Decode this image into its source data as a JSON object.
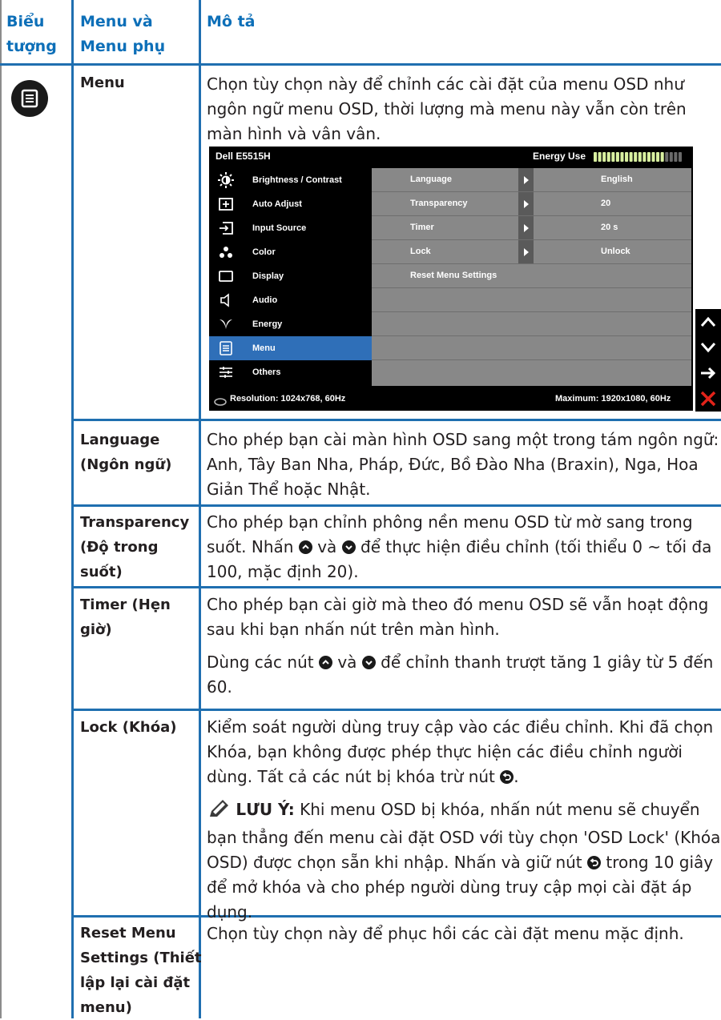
{
  "header": {
    "col1_line1": "Biểu",
    "col1_line2": "tượng",
    "col2_line1": "Menu và",
    "col2_line2": "Menu phụ",
    "col3": "Mô tả"
  },
  "rows": {
    "menu": {
      "label": "Menu",
      "desc_line1": "Chọn tùy chọn này để chỉnh các cài đặt của menu OSD như",
      "desc_line2": "ngôn ngữ menu OSD, thời lượng mà menu này vẫn còn trên",
      "desc_line3": "màn hình và vân vân."
    },
    "language": {
      "label_line1": "Language",
      "label_line2": "(Ngôn ngữ)",
      "desc_line1": "Cho phép bạn cài màn hình OSD sang một trong tám ngôn ngữ:",
      "desc_line2": "Anh, Tây Ban Nha, Pháp, Đức, Bồ Đào Nha (Braxin), Nga, Hoa",
      "desc_line3": "Giản Thể hoặc Nhật."
    },
    "transparency": {
      "label_line1": "Transparency",
      "label_line2": "(Độ trong",
      "label_line3": "suốt)",
      "desc_line1": "Cho phép bạn chỉnh phông nền menu OSD từ mờ sang trong",
      "desc_line2a": "suốt. Nhấn",
      "desc_line2b": "và",
      "desc_line2c": "để thực hiện điều chỉnh (tối thiểu 0 ~ tối đa",
      "desc_line3": "100, mặc định 20)."
    },
    "timer": {
      "label_line1": "Timer (Hẹn",
      "label_line2": "giờ)",
      "desc_line1": "Cho phép bạn cài giờ mà theo đó menu OSD sẽ vẫn hoạt động",
      "desc_line2": "sau khi bạn nhấn nút trên màn hình.",
      "desc_line3a": "Dùng các nút",
      "desc_line3b": "và",
      "desc_line3c": "để chỉnh thanh trượt tăng 1 giây từ 5 đến",
      "desc_line4": "60."
    },
    "lock": {
      "label": "Lock (Khóa)",
      "desc_line1": "Kiểm soát người dùng truy cập vào các điều chỉnh. Khi đã chọn",
      "desc_line2": "Khóa, bạn không được phép thực hiện các điều chỉnh người",
      "desc_line3a": "dùng. Tất cả các nút bị khóa trừ nút",
      "desc_line3b": ".",
      "note_label": "LƯU Ý:",
      "note_line1": "Khi menu OSD bị khóa, nhấn nút menu sẽ chuyển",
      "note_line2": "bạn thẳng đến menu cài đặt OSD với tùy chọn 'OSD Lock' (Khóa",
      "note_line3a": "OSD) được chọn sẵn khi nhập. Nhấn và giữ nút",
      "note_line3b": "trong 10 giây",
      "note_line4": "để mở khóa và cho phép người dùng truy cập mọi cài đặt áp",
      "note_line5": "dụng."
    },
    "reset": {
      "label_line1": "Reset Menu",
      "label_line2": "Settings (Thiết",
      "label_line3": "lập lại cài đặt",
      "label_line4": "menu)",
      "desc_line1": "Chọn tùy chọn này để phục hồi các cài đặt menu mặc định."
    }
  },
  "osd": {
    "model": "Dell E5515H",
    "energy_label": "Energy Use",
    "energy_level": 0.78,
    "left_items": [
      {
        "label": "Brightness / Contrast",
        "icon": "brightness-icon"
      },
      {
        "label": "Auto Adjust",
        "icon": "auto-adjust-icon"
      },
      {
        "label": "Input Source",
        "icon": "input-source-icon"
      },
      {
        "label": "Color",
        "icon": "color-icon"
      },
      {
        "label": "Display",
        "icon": "display-icon"
      },
      {
        "label": "Audio",
        "icon": "speaker-icon"
      },
      {
        "label": "Energy",
        "icon": "energy-leaf-icon"
      },
      {
        "label": "Menu",
        "icon": "menu-icon",
        "selected": true
      },
      {
        "label": "Others",
        "icon": "others-icon"
      }
    ],
    "right_rows": [
      {
        "label": "Language",
        "value": "English"
      },
      {
        "label": "Transparency",
        "value": "20"
      },
      {
        "label": "Timer",
        "value": "20 s"
      },
      {
        "label": "Lock",
        "value": "Unlock"
      },
      {
        "label": "Reset Menu Settings",
        "value": ""
      }
    ],
    "resolution": "Resolution: 1024x768, 60Hz",
    "maximum": "Maximum: 1920x1080, 60Hz",
    "nav_buttons": [
      "up-arrow-icon",
      "down-arrow-icon",
      "right-arrow-icon",
      "close-icon"
    ]
  },
  "colors": {
    "header_text": "#0d6fb8",
    "grid": "#1f6fb0",
    "osd_selected": "#2f6fb8",
    "osd_panel": "#888888",
    "close_red": "#e2231a"
  }
}
